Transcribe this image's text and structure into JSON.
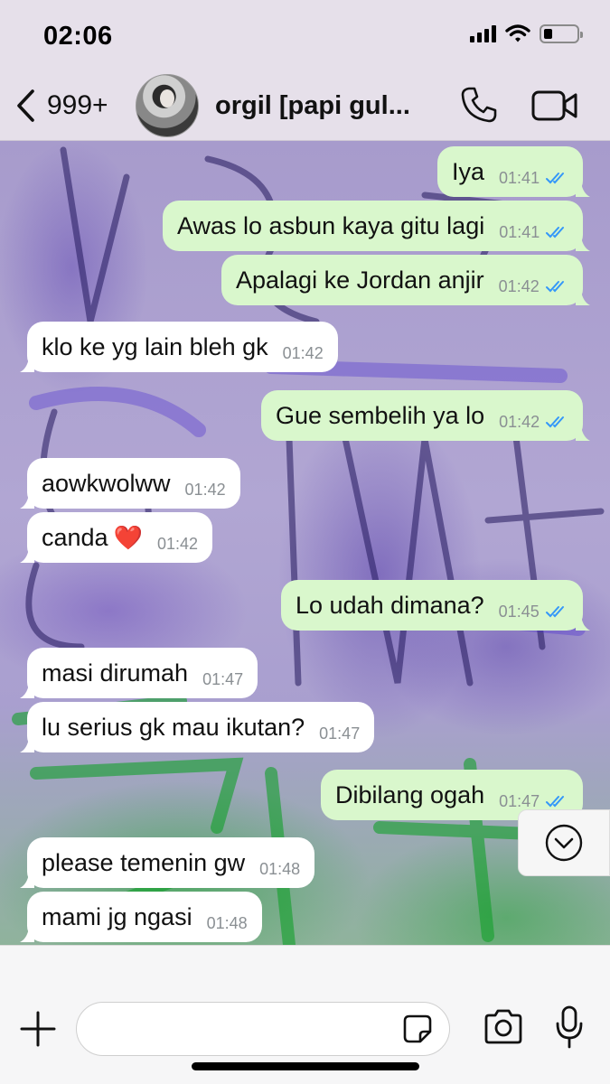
{
  "status_bar": {
    "time": "02:06",
    "battery_percent": 25
  },
  "header": {
    "back_count": "999+",
    "contact_name": "orgil [papi gul..."
  },
  "messages": [
    {
      "direction": "out",
      "text": "Iya",
      "time": "01:41",
      "read": true
    },
    {
      "direction": "out",
      "text": "Awas lo asbun kaya gitu lagi",
      "time": "01:41",
      "read": true
    },
    {
      "direction": "out",
      "text": "Apalagi ke Jordan anjir",
      "time": "01:42",
      "read": true
    },
    {
      "direction": "in",
      "text": "klo ke yg lain bleh gk",
      "time": "01:42"
    },
    {
      "direction": "out",
      "text": "Gue sembelih ya lo",
      "time": "01:42",
      "read": true
    },
    {
      "direction": "in",
      "text": "aowkwolww",
      "time": "01:42"
    },
    {
      "direction": "in",
      "text": "canda",
      "emoji": "❤️",
      "time": "01:42"
    },
    {
      "direction": "out",
      "text": "Lo udah dimana?",
      "time": "01:45",
      "read": true
    },
    {
      "direction": "in",
      "text": "masi dirumah",
      "time": "01:47"
    },
    {
      "direction": "in",
      "text": "lu serius gk mau ikutan?",
      "time": "01:47"
    },
    {
      "direction": "out",
      "text": "Dibilang ogah",
      "time": "01:47",
      "read": true
    },
    {
      "direction": "in",
      "text": "please temenin gw",
      "time": "01:48"
    },
    {
      "direction": "in",
      "text": "mami jg ngasi",
      "time": "01:48"
    }
  ],
  "composer": {
    "placeholder": "",
    "value": ""
  },
  "colors": {
    "outgoing_bubble": "#d9f7cc",
    "incoming_bubble": "#ffffff",
    "read_ticks": "#3497f9"
  }
}
